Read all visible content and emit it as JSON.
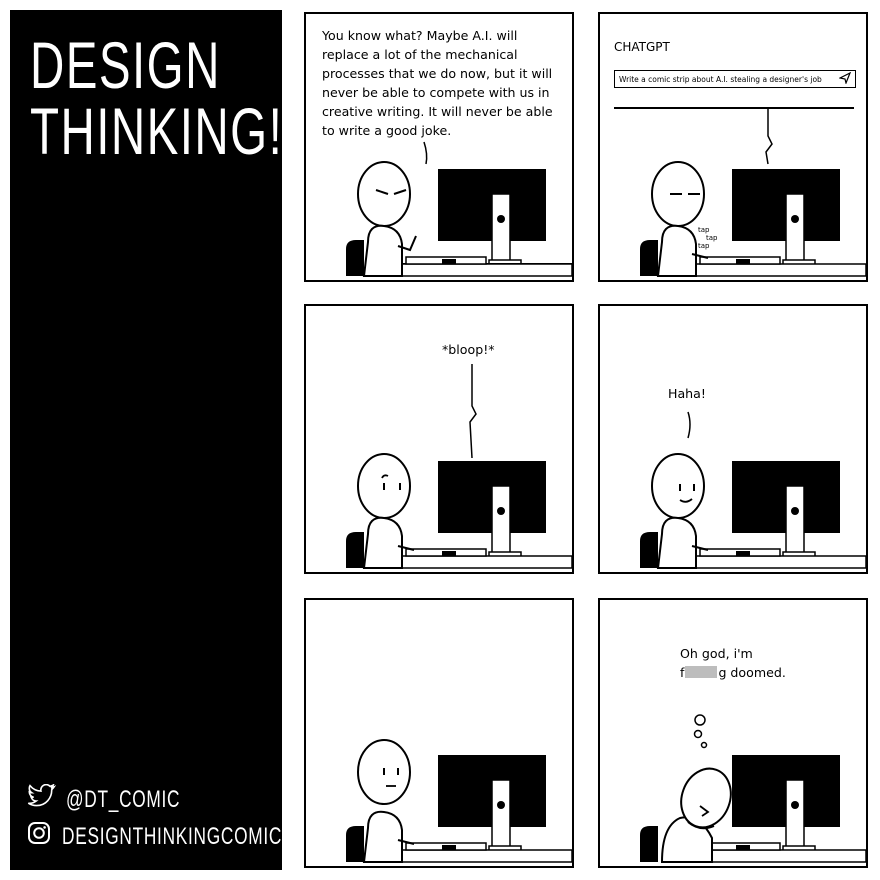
{
  "sidebar": {
    "title_lines": [
      "DESIGN",
      "THINKING!"
    ],
    "twitter_handle": "@DT_COMIC",
    "instagram_handle": "DESIGNTHINKINGCOMIC",
    "icons": [
      "twitter-bird-icon",
      "instagram-icon"
    ]
  },
  "panels": {
    "p1": {
      "dialog": "You know what? Maybe A.I. will replace a lot of the mechanical processes that we do now, but it will never be able to compete with us in creative writing. It will never be able to write a good joke."
    },
    "p2": {
      "app_name": "CHATGPT",
      "prompt": "Write a comic strip about A.I. stealing a designer's job",
      "sfx": [
        "tap",
        "tap",
        "tap"
      ]
    },
    "p3": {
      "dialog": "*bloop!*"
    },
    "p4": {
      "dialog": "Haha!"
    },
    "p5": {},
    "p6": {
      "dialog_line1": "Oh god, i'm",
      "dialog_prefix": "f",
      "dialog_suffix": "g doomed."
    }
  },
  "colors": {
    "ink": "#000000",
    "paper": "#ffffff",
    "censor": "#bdbdbd"
  }
}
